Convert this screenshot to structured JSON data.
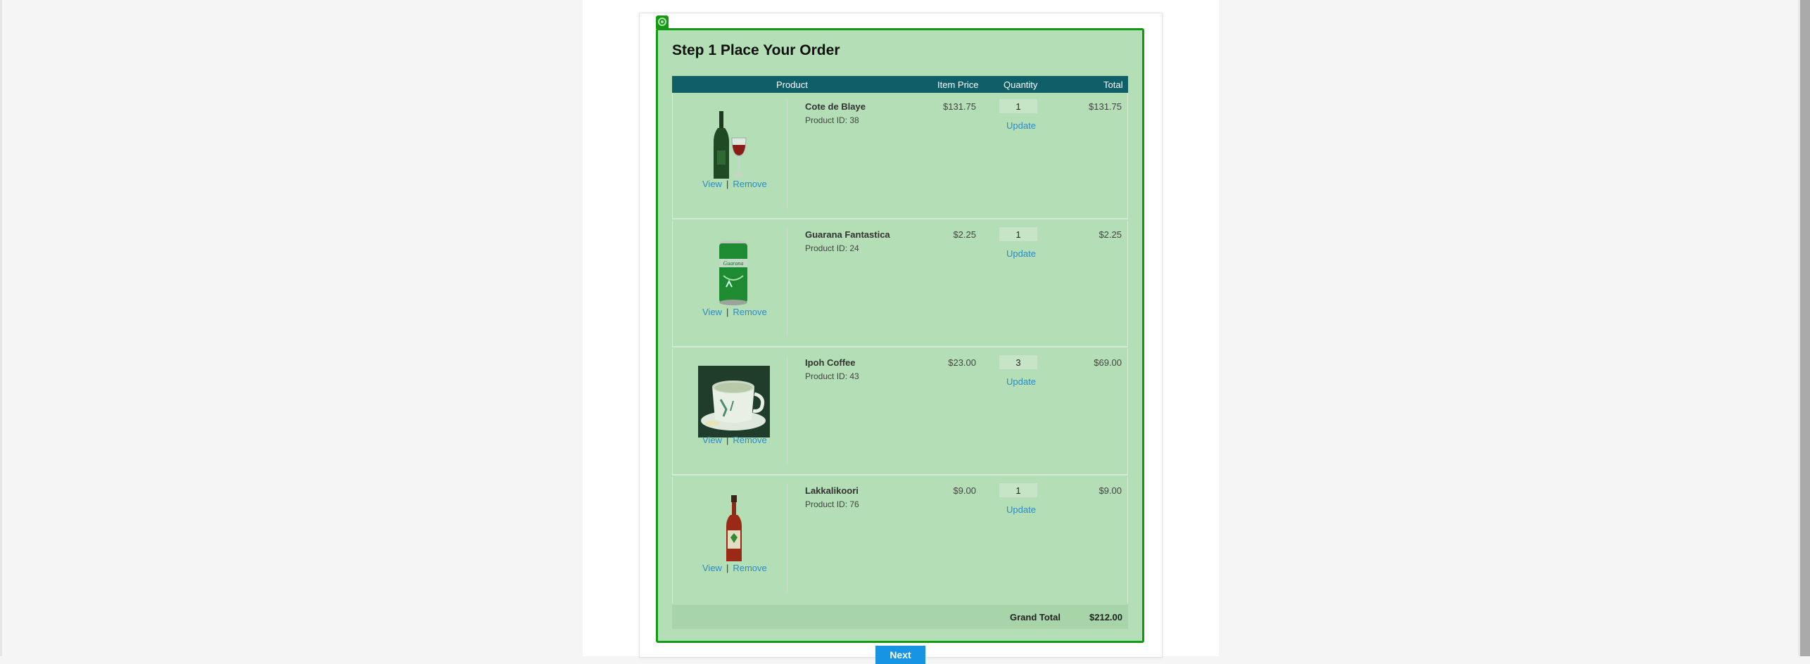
{
  "page_title": "Step 1 Place Your Order",
  "table": {
    "headers": {
      "product": "Product",
      "item_price": "Item Price",
      "quantity": "Quantity",
      "total": "Total"
    },
    "rows": [
      {
        "name": "Cote de Blaye",
        "product_id": "Product ID: 38",
        "price": "$131.75",
        "quantity": "1",
        "total": "$131.75",
        "image_icon": "wine-bottle-glass-icon",
        "view": "View",
        "separator": "|",
        "remove": "Remove",
        "update": "Update"
      },
      {
        "name": "Guarana Fantastica",
        "product_id": "Product ID: 24",
        "price": "$2.25",
        "quantity": "1",
        "total": "$2.25",
        "image_icon": "soda-can-icon",
        "view": "View",
        "separator": "|",
        "remove": "Remove",
        "update": "Update"
      },
      {
        "name": "Ipoh Coffee",
        "product_id": "Product ID: 43",
        "price": "$23.00",
        "quantity": "3",
        "total": "$69.00",
        "image_icon": "coffee-cup-icon",
        "view": "View",
        "separator": "|",
        "remove": "Remove",
        "update": "Update"
      },
      {
        "name": "Lakkalikoori",
        "product_id": "Product ID: 76",
        "price": "$9.00",
        "quantity": "1",
        "total": "$9.00",
        "image_icon": "liqueur-bottle-icon",
        "view": "View",
        "separator": "|",
        "remove": "Remove",
        "update": "Update"
      }
    ],
    "grand_total_label": "Grand Total",
    "grand_total_value": "$212.00"
  },
  "next_label": "Next",
  "colors": {
    "header_bg": "#0f5f68",
    "highlight_fill": "#b4deb5",
    "highlight_border": "#139a13",
    "link": "#2a8cc8",
    "next_button": "#1794e4"
  }
}
